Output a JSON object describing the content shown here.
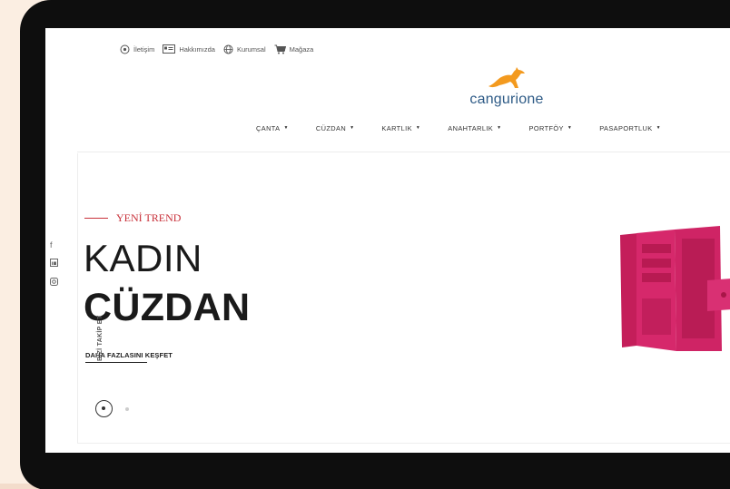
{
  "topbar": {
    "items": [
      {
        "icon": "headset-icon",
        "label": "İletişim"
      },
      {
        "icon": "id-card-icon",
        "label": "Hakkımızda"
      },
      {
        "icon": "globe-icon",
        "label": "Kurumsal"
      },
      {
        "icon": "cart-icon",
        "label": "Mağaza"
      }
    ]
  },
  "logo": {
    "text": "cangurione",
    "icon": "kangaroo-logo-icon",
    "accent": "#f39a1f"
  },
  "nav": {
    "items": [
      {
        "label": "ÇANTA"
      },
      {
        "label": "CÜZDAN"
      },
      {
        "label": "KARTLIK"
      },
      {
        "label": "ANAHTARLIK"
      },
      {
        "label": "PORTFÖY"
      },
      {
        "label": "PASAPORTLUK"
      }
    ]
  },
  "hero": {
    "eyebrow": "YENİ TREND",
    "title_line1": "KADIN",
    "title_line2": "CÜZDAN",
    "cta": "DAHA FAZLASINI KEŞFET",
    "accent": "#c8313a",
    "slides": {
      "count": 2,
      "active": 1
    }
  },
  "social": {
    "icons": [
      "facebook-icon",
      "linkedin-icon",
      "instagram-icon"
    ],
    "label": "BİZİ TAKİP ET"
  }
}
